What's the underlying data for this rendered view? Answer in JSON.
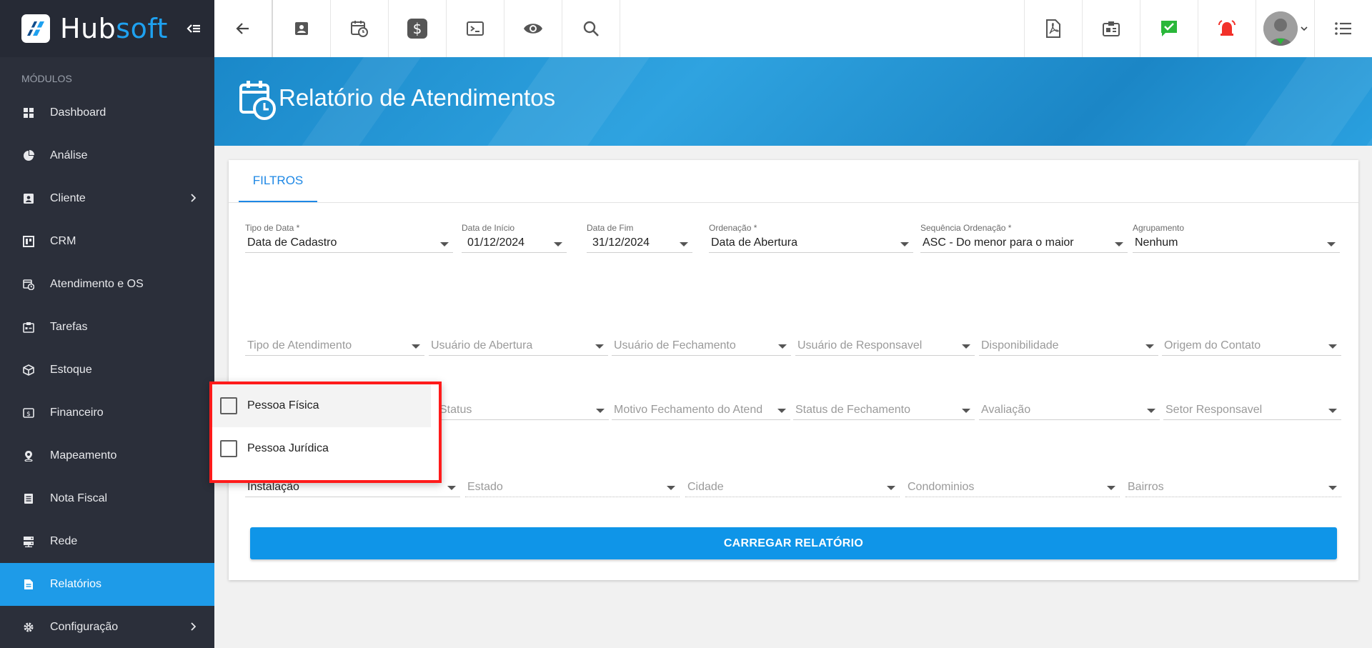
{
  "brand": {
    "name_part1": "Hub",
    "name_part2": "soft"
  },
  "sidebar": {
    "section_label": "MÓDULOS",
    "items": [
      {
        "label": "Dashboard",
        "icon": "dashboard-icon"
      },
      {
        "label": "Análise",
        "icon": "pie-chart-icon"
      },
      {
        "label": "Cliente",
        "icon": "contact-card-icon",
        "has_submenu": true
      },
      {
        "label": "CRM",
        "icon": "crm-board-icon"
      },
      {
        "label": "Atendimento e OS",
        "icon": "calendar-clock-icon"
      },
      {
        "label": "Tarefas",
        "icon": "tasks-icon"
      },
      {
        "label": "Estoque",
        "icon": "box-icon"
      },
      {
        "label": "Financeiro",
        "icon": "money-icon"
      },
      {
        "label": "Mapeamento",
        "icon": "map-pin-icon"
      },
      {
        "label": "Nota Fiscal",
        "icon": "invoice-icon"
      },
      {
        "label": "Rede",
        "icon": "server-icon"
      },
      {
        "label": "Relatórios",
        "icon": "report-icon",
        "active": true
      },
      {
        "label": "Configuração",
        "icon": "gear-icon",
        "has_submenu": true
      }
    ]
  },
  "topbar": {
    "left_icons": [
      "back-arrow-icon",
      "contact-card-icon",
      "calendar-clock-icon",
      "dollar-icon",
      "terminal-icon",
      "eye-icon",
      "search-icon"
    ],
    "right_icons": [
      "pdf-icon",
      "id-badge-icon",
      "chat-check-icon",
      "alarm-bell-icon"
    ],
    "colors": {
      "chat": "#2ab73a",
      "alarm": "#f2312a"
    }
  },
  "page": {
    "title": "Relatório de Atendimentos"
  },
  "tabs": [
    {
      "label": "FILTROS"
    }
  ],
  "filters": {
    "row1": [
      {
        "label": "Tipo de Data *",
        "value": "Data de Cadastro"
      },
      {
        "label": "Data de Início",
        "value": "01/12/2024"
      },
      {
        "label": "Data de Fim",
        "value": "31/12/2024"
      },
      {
        "label": "Ordenação *",
        "value": "Data de Abertura"
      },
      {
        "label": "Sequência Ordenação *",
        "value": "ASC - Do menor para o maior"
      },
      {
        "label": "Agrupamento",
        "value": "Nenhum"
      }
    ],
    "row2": [
      {
        "placeholder": "Tipo de Atendimento"
      },
      {
        "placeholder": "Usuário de Abertura"
      },
      {
        "placeholder": "Usuário de Fechamento"
      },
      {
        "placeholder": "Usuário de Responsavel"
      },
      {
        "placeholder": "Disponibilidade"
      },
      {
        "placeholder": "Origem do Contato"
      }
    ],
    "row3": [
      {
        "placeholder": "Status"
      },
      {
        "placeholder": "Motivo Fechamento do Atend"
      },
      {
        "placeholder": "Status de Fechamento"
      },
      {
        "placeholder": "Avaliação"
      },
      {
        "placeholder": "Setor Responsavel"
      }
    ],
    "row4": [
      {
        "value": "Instalação"
      },
      {
        "placeholder": "Estado"
      },
      {
        "placeholder": "Cidade"
      },
      {
        "placeholder": "Condominios"
      },
      {
        "placeholder": "Bairros"
      }
    ]
  },
  "dropdown": {
    "options": [
      {
        "label": "Pessoa Física",
        "checked": false
      },
      {
        "label": "Pessoa Jurídica",
        "checked": false
      }
    ]
  },
  "actions": {
    "load_report": "CARREGAR RELATÓRIO"
  }
}
